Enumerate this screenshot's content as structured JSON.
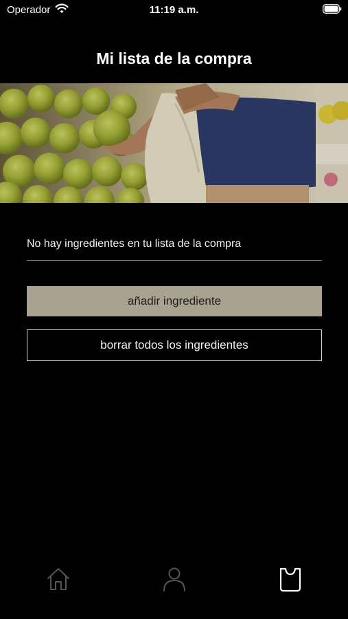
{
  "status_bar": {
    "carrier": "Operador",
    "time": "11:19 a.m.",
    "icons": [
      "wifi-icon",
      "battery-icon"
    ]
  },
  "header": {
    "title": "Mi lista de la compra"
  },
  "hero": {
    "description_icon": "hero-image"
  },
  "shopping_list": {
    "empty_message": "No hay ingredientes en tu lista de la compra",
    "items": []
  },
  "actions": {
    "add_label": "añadir ingrediente",
    "clear_label": "borrar todos los ingredientes"
  },
  "tab_bar": {
    "tabs": [
      {
        "icon": "home-icon",
        "active": false
      },
      {
        "icon": "profile-icon",
        "active": false
      },
      {
        "icon": "shopping-bag-icon",
        "active": true
      }
    ]
  },
  "colors": {
    "background": "#000000",
    "accent_button": "#a8a291",
    "tab_inactive": "#555555",
    "tab_active": "#ffffff"
  }
}
